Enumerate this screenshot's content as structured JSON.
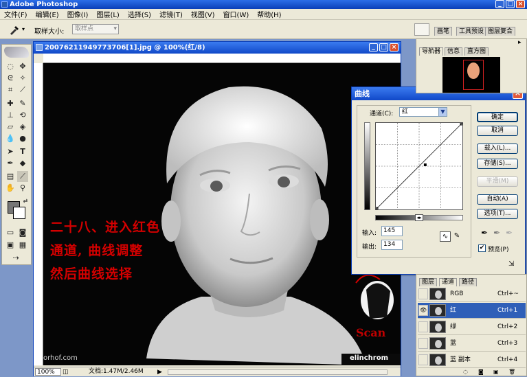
{
  "app": {
    "title": "Adobe Photoshop",
    "window_buttons": [
      "_",
      "□",
      "×"
    ]
  },
  "menu": [
    "文件(F)",
    "编辑(E)",
    "图像(I)",
    "图层(L)",
    "选择(S)",
    "滤镜(T)",
    "视图(V)",
    "窗口(W)",
    "帮助(H)"
  ],
  "options_bar": {
    "sample_size_label": "取样大小:",
    "sample_size_value": "取样点",
    "well_tabs": [
      "画笔",
      "工具预设",
      "图层复合"
    ]
  },
  "document": {
    "title": "20076211949773706[1].jpg @ 100%(红/8)",
    "zoom": "100%",
    "doc_info": "文档:1.47M/2.46M",
    "caption_lines": [
      "二十八、进入红色",
      "通道, 曲线调整",
      "然后曲线选择"
    ],
    "watermark_left": "orhof.com",
    "watermark_right": "elinchrom",
    "logo_text": "Scan"
  },
  "curves_dialog": {
    "title": "曲线",
    "channel_label": "通道(C):",
    "channel_value": "红",
    "input_label": "输入:",
    "input_value": "145",
    "output_label": "输出:",
    "output_value": "134",
    "buttons": {
      "ok": "确定",
      "cancel": "取消",
      "load": "载入(L)...",
      "save": "存储(S)...",
      "smooth": "平滑(M)",
      "auto": "自动(A)",
      "options": "选项(T)..."
    },
    "preview_label": "预览(P)",
    "preview_checked": true
  },
  "navigator_panel": {
    "tabs": [
      "导航器",
      "信息",
      "直方图"
    ]
  },
  "channels_panel": {
    "tabs": [
      "图层",
      "通道",
      "路径"
    ],
    "rows": [
      {
        "name": "RGB",
        "shortcut": "Ctrl+~",
        "visible": false,
        "selected": false
      },
      {
        "name": "红",
        "shortcut": "Ctrl+1",
        "visible": true,
        "selected": true
      },
      {
        "name": "绿",
        "shortcut": "Ctrl+2",
        "visible": false,
        "selected": false
      },
      {
        "name": "蓝",
        "shortcut": "Ctrl+3",
        "visible": false,
        "selected": false
      },
      {
        "name": "蓝 副本",
        "shortcut": "Ctrl+4",
        "visible": false,
        "selected": false
      }
    ]
  },
  "colors": {
    "accent": "#0a3fb8",
    "caption": "#d40000",
    "panel_bg": "#ece9d8",
    "workspace": "#7d97c8"
  }
}
